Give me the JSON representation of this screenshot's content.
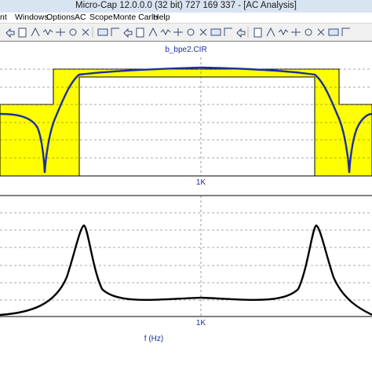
{
  "window": {
    "title": "Micro-Cap 12.0.0.0 (32 bit) 727 169 337 - [AC Analysis]"
  },
  "menu": {
    "items": [
      "nt",
      "Windows",
      "Options",
      "AC",
      "Scope",
      "Monte Carlo",
      "Help"
    ]
  },
  "toolbar": {
    "icons": [
      "undo-icon",
      "redo-icon",
      "copy-icon",
      "paste-icon",
      "cut-icon",
      "delete-icon",
      "find-icon",
      "cursor-icon",
      "wire-icon",
      "resistor-icon",
      "capacitor-icon",
      "inductor-icon",
      "diode-icon",
      "ground-icon",
      "node-icon",
      "flag-icon",
      "pin-icon",
      "text-icon",
      "probe-icon",
      "window-icon",
      "tile-h-icon",
      "tile-v-icon",
      "cascade-icon",
      "grid-icon",
      "zoom-icon",
      "chart-icon",
      "table-icon"
    ]
  },
  "plot": {
    "title": "b_bpe2.CIR",
    "xlabel": "f (Hz)",
    "top_tick": "1K",
    "bottom_tick": "1K"
  },
  "colors": {
    "trace_top": "#1c2f9e",
    "trace_bottom": "#000000",
    "mask_fill": "#ffff00",
    "grid": "#000000",
    "label": "#1c2f9e"
  },
  "chart_data": [
    {
      "type": "line",
      "title": "b_bpe2.CIR",
      "xlabel": "",
      "ylabel": "",
      "x_tick_labels": [
        "1K"
      ],
      "grid": true,
      "series": [
        {
          "values": [
            0.62,
            0.63,
            0.68,
            0.05,
            0.7,
            0.9,
            0.95,
            0.97,
            0.99,
            1.0,
            0.99,
            0.97,
            0.95,
            0.9,
            0.7,
            0.05,
            0.68,
            0.63,
            0.62
          ]
        }
      ],
      "mask": "yellow filter-specification template (passband / stopband)"
    },
    {
      "type": "line",
      "title": "",
      "xlabel": "f (Hz)",
      "ylabel": "",
      "x_tick_labels": [
        "1K"
      ],
      "grid": true,
      "series": [
        {
          "values": [
            0.02,
            0.1,
            0.9,
            0.12,
            0.05,
            0.1,
            0.14,
            0.1,
            0.05,
            0.12,
            0.9,
            0.1,
            0.02
          ]
        }
      ]
    }
  ]
}
